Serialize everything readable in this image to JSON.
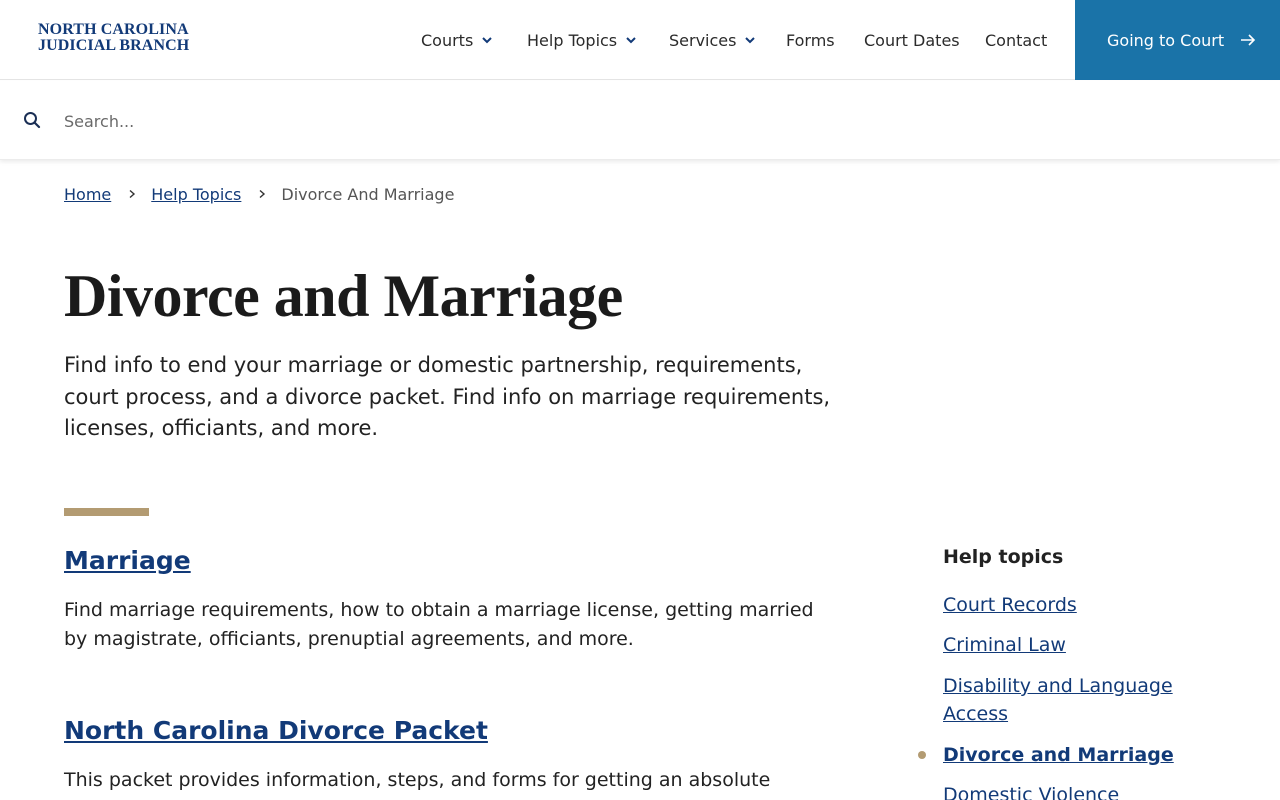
{
  "header": {
    "logo_line1": "NORTH CAROLINA",
    "logo_line2": "JUDICIAL BRANCH",
    "nav": [
      {
        "label": "Courts",
        "has_dropdown": true
      },
      {
        "label": "Help Topics",
        "has_dropdown": true
      },
      {
        "label": "Services",
        "has_dropdown": true
      },
      {
        "label": "Forms",
        "has_dropdown": false
      },
      {
        "label": "Court Dates",
        "has_dropdown": false
      },
      {
        "label": "Contact",
        "has_dropdown": false
      }
    ],
    "cta_label": "Going to Court",
    "cta_color": "#1a73a8"
  },
  "search": {
    "placeholder": "Search...",
    "value": ""
  },
  "breadcrumb": {
    "home": "Home",
    "help_topics": "Help Topics",
    "current": "Divorce And Marriage"
  },
  "main": {
    "title": "Divorce and Marriage",
    "intro": "Find info to end your marriage or domestic partnership, requirements, court process, and a divorce packet. Find info on marriage requirements, licenses, officiants, and more.",
    "accent_color": "#b39b72",
    "sections": [
      {
        "title": "Marriage",
        "description": "Find marriage requirements, how to obtain a marriage license, getting married by magistrate, officiants, prenuptial agreements, and more."
      },
      {
        "title": "North Carolina Divorce Packet",
        "description": "This packet provides information, steps, and forms for getting an absolute divorce."
      }
    ]
  },
  "sidebar": {
    "heading": "Help topics",
    "items": [
      {
        "label": "Court Records",
        "active": false
      },
      {
        "label": "Criminal Law",
        "active": false
      },
      {
        "label": "Disability and Language Access",
        "active": false
      },
      {
        "label": "Divorce and Marriage",
        "active": true
      },
      {
        "label": "Domestic Violence",
        "active": false
      }
    ]
  }
}
